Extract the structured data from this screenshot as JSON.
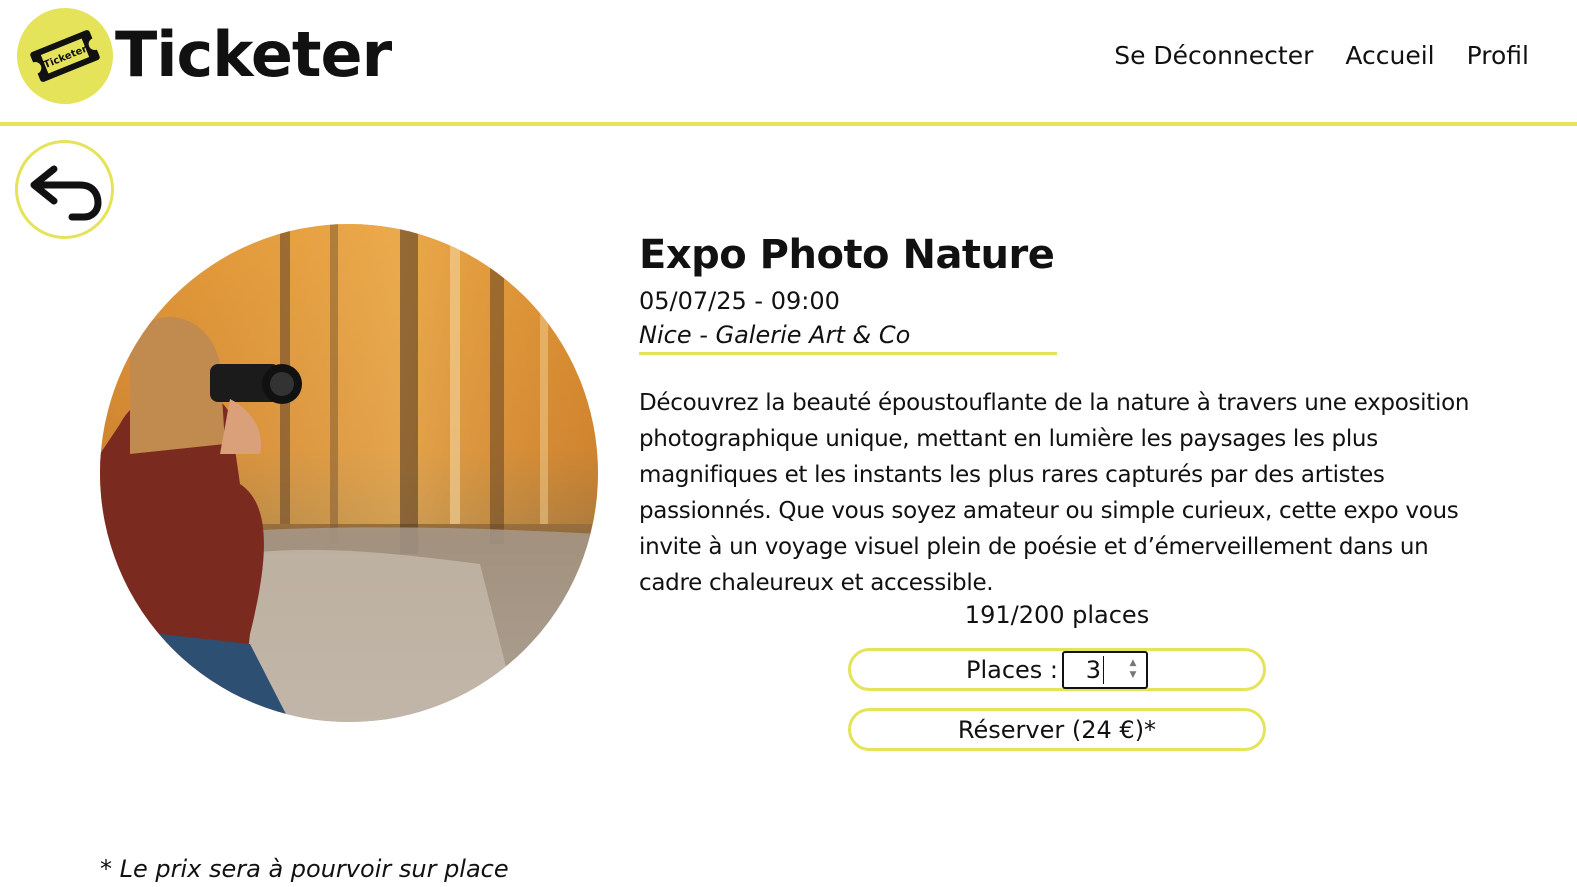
{
  "header": {
    "logo_badge_text": "Ticketer",
    "brand": "Ticketer",
    "nav": [
      {
        "label": "Se Déconnecter"
      },
      {
        "label": "Accueil"
      },
      {
        "label": "Profil"
      }
    ]
  },
  "event": {
    "title": "Expo Photo Nature",
    "datetime": "05/07/25 - 09:00",
    "location": "Nice - Galerie Art & Co",
    "description": "Découvrez la beauté époustouflante de la nature à travers une exposition photographique unique, mettant en lumière les paysages les plus magnifiques et les instants les plus rares capturés par des artistes passionnés. Que vous soyez amateur ou simple curieux, cette expo vous invite à un voyage visuel plein de poésie et d’émerveillement dans un cadre chaleureux et accessible.",
    "availability": "191/200 places"
  },
  "booking": {
    "places_label": "Places :",
    "places_value": "3",
    "reserve_label": "Réserver (24 €)*"
  },
  "footnote": "* Le prix sera à pourvoir sur place",
  "colors": {
    "accent": "#e4e35a",
    "text": "#111111",
    "background": "#ffffff"
  },
  "icons": {
    "logo": "ticket-icon",
    "back": "back-arrow-icon",
    "spinner_up": "chevron-up-icon",
    "spinner_down": "chevron-down-icon"
  }
}
